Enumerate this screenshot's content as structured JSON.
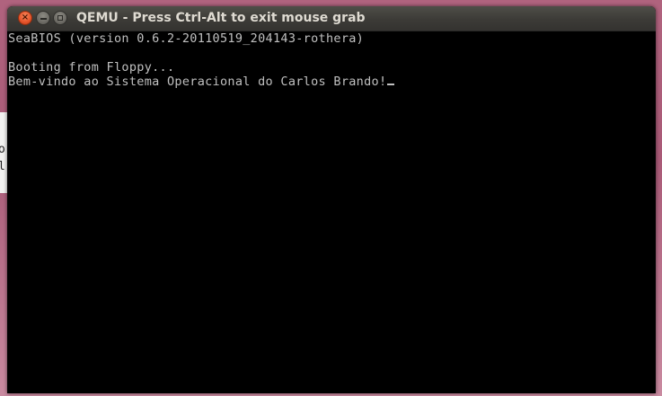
{
  "background_window": {
    "partial_text_top": "o",
    "partial_text_bottom": "l"
  },
  "window": {
    "title": "QEMU - Press Ctrl-Alt to exit mouse grab",
    "buttons": {
      "close_glyph": "×"
    }
  },
  "console": {
    "lines": [
      "SeaBIOS (version 0.6.2-20110519_204143-rothera)",
      "Booting from Floppy...",
      "Bem-vindo ao Sistema Operacional do Carlos Brando!"
    ],
    "cursor": "_"
  },
  "colors": {
    "console_background": "#000000",
    "console_text": "#c0c0c0",
    "titlebar": "#3c3b37",
    "title_text": "#dfdbd2",
    "close_button": "#e6532a",
    "desktop": "#b0637e"
  }
}
